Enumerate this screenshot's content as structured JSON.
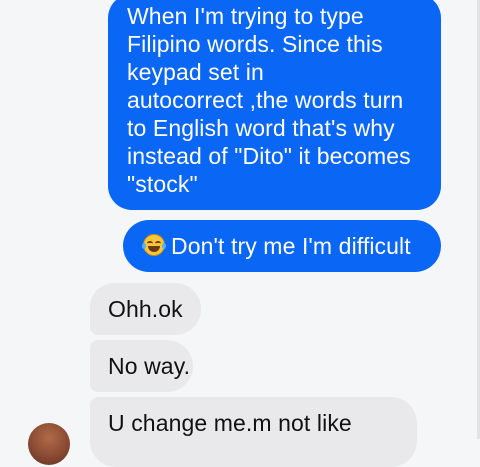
{
  "conversation": {
    "messages": [
      {
        "direction": "outgoing",
        "text": "When I'm trying to type\nFilipino words. Since this\nkeypad set in\nautocorrect ,the words turn\nto English word that's why\ninstead of \"Dito\" it becomes\n\"stock\""
      },
      {
        "direction": "outgoing",
        "emoji": "laughing-tears-emoji",
        "text": "Don't try me I'm difficult"
      },
      {
        "direction": "incoming",
        "text": "Ohh.ok"
      },
      {
        "direction": "incoming",
        "text": "No way."
      },
      {
        "direction": "incoming",
        "text": "U change me.m not like"
      }
    ]
  },
  "colors": {
    "outgoing_bubble": "#0a66f5",
    "incoming_bubble": "#e9e9eb",
    "background": "#f5f6f7"
  }
}
